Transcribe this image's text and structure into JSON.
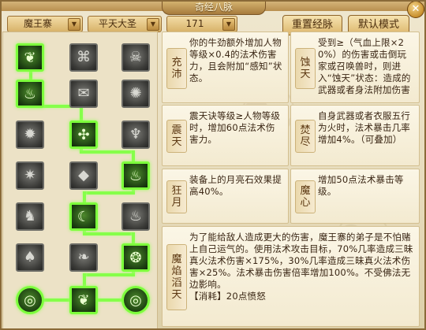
{
  "window": {
    "title": "奇经八脉",
    "close_label": "✕"
  },
  "selectors": {
    "school": "魔王寨",
    "path": "平天大圣",
    "points": "171",
    "arrow": "▼"
  },
  "buttons": {
    "reset": "重置经脉",
    "default": "默认模式"
  },
  "tree": [
    {
      "id": "n1",
      "icon": "flame-figure-icon",
      "glyph": "❦",
      "active": true
    },
    {
      "id": "n2",
      "icon": "spiral-rune-icon",
      "glyph": "⌘",
      "active": false
    },
    {
      "id": "n3",
      "icon": "demon-mask-icon",
      "glyph": "☠",
      "active": false
    },
    {
      "id": "n4",
      "icon": "fire-wave-icon",
      "glyph": "♨",
      "active": true
    },
    {
      "id": "n5",
      "icon": "scroll-rune-icon",
      "glyph": "✉",
      "active": false
    },
    {
      "id": "n6",
      "icon": "sun-wheel-icon",
      "glyph": "✺",
      "active": false
    },
    {
      "id": "n7",
      "icon": "bagua-disc-icon",
      "glyph": "✹",
      "active": false
    },
    {
      "id": "n8",
      "icon": "crossed-blades-icon",
      "glyph": "✣",
      "active": true
    },
    {
      "id": "n9",
      "icon": "blaze-icon",
      "glyph": "♆",
      "active": false
    },
    {
      "id": "n10",
      "icon": "burst-icon",
      "glyph": "✷",
      "active": false
    },
    {
      "id": "n11",
      "icon": "rock-shield-icon",
      "glyph": "◆",
      "active": false
    },
    {
      "id": "n12",
      "icon": "fire-column-icon",
      "glyph": "♨",
      "active": true
    },
    {
      "id": "n13",
      "icon": "beast-claw-icon",
      "glyph": "♞",
      "active": false
    },
    {
      "id": "n14",
      "icon": "moon-ring-icon",
      "glyph": "☾",
      "active": true
    },
    {
      "id": "n15",
      "icon": "flame-pillar-icon",
      "glyph": "♨",
      "active": false
    },
    {
      "id": "n16",
      "icon": "gourd-icon",
      "glyph": "♠",
      "active": false
    },
    {
      "id": "n17",
      "icon": "spirit-fire-icon",
      "glyph": "❧",
      "active": false
    },
    {
      "id": "n18",
      "icon": "swirl-seal-icon",
      "glyph": "❂",
      "active": true
    },
    {
      "id": "n19",
      "icon": "coil-orb-icon",
      "glyph": "◎",
      "active": true
    },
    {
      "id": "n20",
      "icon": "flame-hand-icon",
      "glyph": "❦",
      "active": true
    },
    {
      "id": "n21",
      "icon": "serpent-orb-icon",
      "glyph": "◎",
      "active": true
    }
  ],
  "cards": [
    {
      "tag": "充沛",
      "text": "你的牛劲额外增加人物等级×0.4的法术伤害力，且会附加“感知”状态。"
    },
    {
      "tag": "蚀天",
      "text": "受到≥（气血上限×20%）的伤害或击倒玩家或召唤兽时，则进入“蚀天”状态：造成的武器或者身法附加伤害"
    },
    {
      "tag": "震天",
      "text": "震天诀等级≥人物等级时，增加60点法术伤害力。"
    },
    {
      "tag": "焚尽",
      "text": "自身武器或者衣服五行为火时，法术暴击几率增加4%。（可叠加）"
    },
    {
      "tag": "狂月",
      "text": "装备上的月亮石效果提高40%。"
    },
    {
      "tag": "魔心",
      "text": "增加50点法术暴击等级。"
    },
    {
      "tag": "魔焰滔天",
      "text": "为了能给敌人造成更大的伤害，魔王寨的弟子是不怕赌上自己运气的。使用法术攻击目标，70%几率造成三昧真火法术伤害×175%，30%几率造成三昧真火法术伤害×25%。法术暴击伤害倍率增加100%。不受佛法无边影响。",
      "footer": "【消耗】20点愤怒"
    }
  ]
}
